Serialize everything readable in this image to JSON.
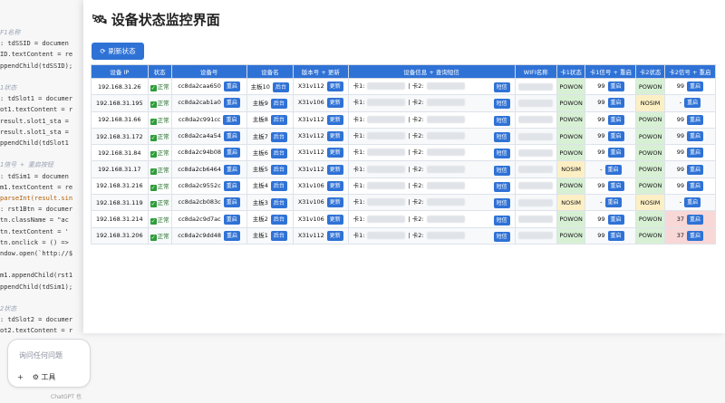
{
  "background": {
    "code_lines": [
      {
        "text": "F1名称",
        "cls": "c"
      },
      {
        "text": ": tdSSID = documen",
        "cls": ""
      },
      {
        "text": "ID.textContent = re",
        "cls": ""
      },
      {
        "text": "ppendChild(tdSSID);",
        "cls": ""
      },
      {
        "text": "",
        "cls": ""
      },
      {
        "text": "1状态",
        "cls": "c"
      },
      {
        "text": ": tdSlot1 = documer",
        "cls": ""
      },
      {
        "text": "ot1.textContent = r",
        "cls": ""
      },
      {
        "text": "result.slot1_sta =",
        "cls": ""
      },
      {
        "text": "result.slot1_sta =",
        "cls": ""
      },
      {
        "text": "ppendChild(tdSlot1",
        "cls": ""
      },
      {
        "text": "",
        "cls": ""
      },
      {
        "text": "1信号 + 重启按钮",
        "cls": "c"
      },
      {
        "text": ": tdSim1 = documen",
        "cls": ""
      },
      {
        "text": "m1.textContent = re",
        "cls": ""
      },
      {
        "text": "parseInt(result.sin",
        "cls": "k"
      },
      {
        "text": ": rst1Btn = documer",
        "cls": ""
      },
      {
        "text": "tn.className = \"ac",
        "cls": ""
      },
      {
        "text": "tn.textContent = '",
        "cls": ""
      },
      {
        "text": "tn.onclick = () =>",
        "cls": ""
      },
      {
        "text": "ndow.open(`http://$",
        "cls": ""
      },
      {
        "text": "",
        "cls": ""
      },
      {
        "text": "m1.appendChild(rst1",
        "cls": ""
      },
      {
        "text": "ppendChild(tdSim1);",
        "cls": ""
      },
      {
        "text": "",
        "cls": ""
      },
      {
        "text": "2状态",
        "cls": "c"
      },
      {
        "text": ": tdSlot2 = documer",
        "cls": ""
      },
      {
        "text": "ot2.textContent = r",
        "cls": ""
      }
    ],
    "chat_placeholder": "询问任何问题",
    "chat_tools_label": "工具",
    "chat_footer": "ChatGPT 也"
  },
  "title": "设备状态监控界面",
  "refresh_label": "刷新状态",
  "headers": [
    "设备 IP",
    "状态",
    "设备号",
    "设备名",
    "版本号 + 更新",
    "设备信息 + 查询短信",
    "WIFI名称",
    "卡1状态",
    "卡1信号 + 重启",
    "卡2状态",
    "卡2信号 + 重启"
  ],
  "button_labels": {
    "restart": "重启",
    "backend": "后台",
    "update": "更新",
    "sms": "短信"
  },
  "status_text": "正常",
  "card_prefix": {
    "c1": "卡1:",
    "c2": "卡2:"
  },
  "rows": [
    {
      "ip": "192.168.31.26",
      "devid": "cc8da2caa650",
      "name": "主板10",
      "ver": "X31v112",
      "c1s": "POWON",
      "c1sig": "99",
      "c2s": "POWON",
      "c2sig": "99"
    },
    {
      "ip": "192.168.31.195",
      "devid": "cc8da2cab1a0",
      "name": "主板9",
      "ver": "X31v106",
      "c1s": "POWON",
      "c1sig": "99",
      "c2s": "NOSIM",
      "c2sig": "-"
    },
    {
      "ip": "192.168.31.66",
      "devid": "cc8da2c991cc",
      "name": "主板8",
      "ver": "X31v112",
      "c1s": "POWON",
      "c1sig": "99",
      "c2s": "POWON",
      "c2sig": "99"
    },
    {
      "ip": "192.168.31.172",
      "devid": "cc8da2ca4a54",
      "name": "主板7",
      "ver": "X31v112",
      "c1s": "POWON",
      "c1sig": "99",
      "c2s": "POWON",
      "c2sig": "99"
    },
    {
      "ip": "192.168.31.84",
      "devid": "cc8da2c94b08",
      "name": "主板6",
      "ver": "X31v112",
      "c1s": "POWON",
      "c1sig": "99",
      "c2s": "POWON",
      "c2sig": "99"
    },
    {
      "ip": "192.168.31.17",
      "devid": "cc8da2cb6464",
      "name": "主板5",
      "ver": "X31v112",
      "c1s": "NOSIM",
      "c1sig": "-",
      "c2s": "POWON",
      "c2sig": "99"
    },
    {
      "ip": "192.168.31.216",
      "devid": "cc8da2c9552c",
      "name": "主板4",
      "ver": "X31v106",
      "c1s": "POWON",
      "c1sig": "99",
      "c2s": "POWON",
      "c2sig": "99"
    },
    {
      "ip": "192.168.31.119",
      "devid": "cc8da2cb083c",
      "name": "主板3",
      "ver": "X31v106",
      "c1s": "NOSIM",
      "c1sig": "-",
      "c2s": "NOSIM",
      "c2sig": "-"
    },
    {
      "ip": "192.168.31.214",
      "devid": "cc8da2c9d7ac",
      "name": "主板2",
      "ver": "X31v106",
      "c1s": "POWON",
      "c1sig": "99",
      "c2s": "POWON",
      "c2sig": "37"
    },
    {
      "ip": "192.168.31.206",
      "devid": "cc8da2c9dd48",
      "name": "主板1",
      "ver": "X31v112",
      "c1s": "POWON",
      "c1sig": "99",
      "c2s": "POWON",
      "c2sig": "37"
    }
  ],
  "colors": {
    "accent": "#2f72d6",
    "ok": "#d7f0d4",
    "warn": "#fcefc4",
    "bad": "#f8d7d7"
  }
}
